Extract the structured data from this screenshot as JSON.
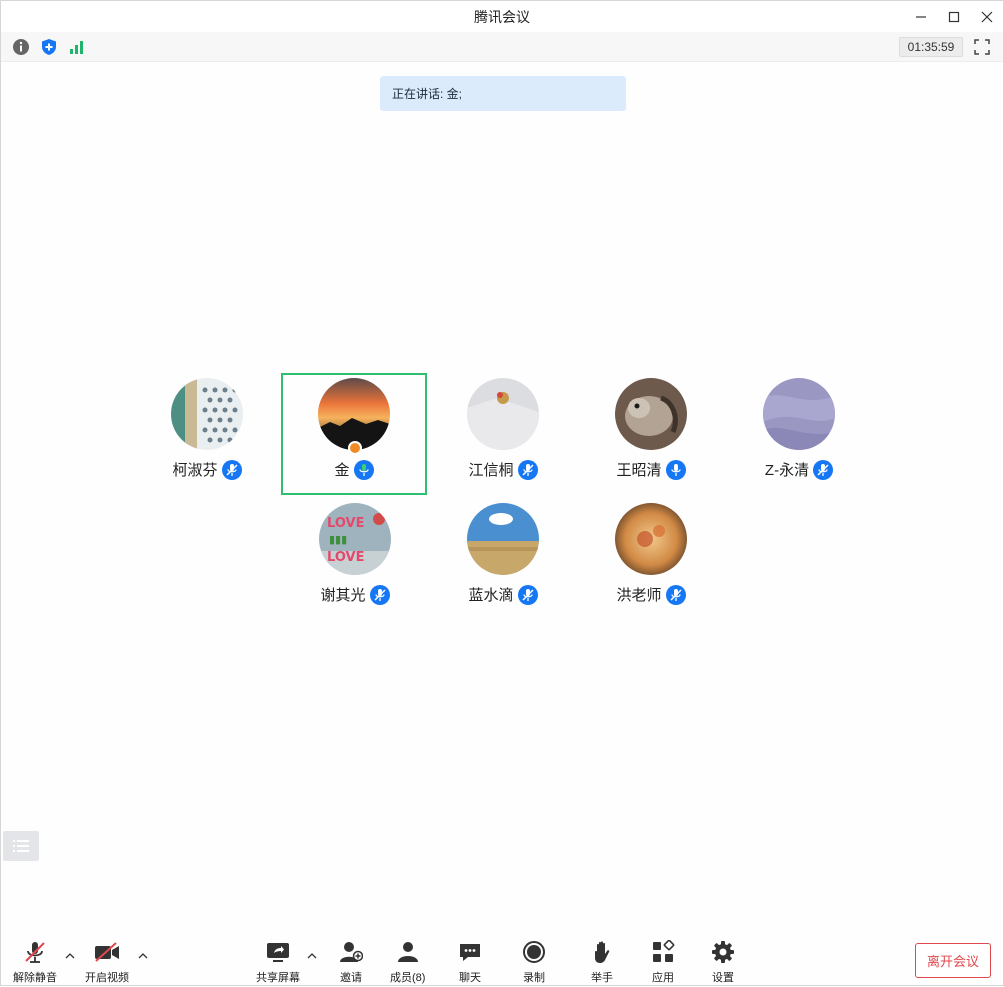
{
  "window": {
    "title": "腾讯会议"
  },
  "infobar": {
    "timer": "01:35:59"
  },
  "speaking": {
    "label": "正在讲话: 金;"
  },
  "participants": [
    {
      "name": "柯淑芬",
      "mic": "muted"
    },
    {
      "name": "金",
      "mic": "speaking",
      "host": true,
      "active": true
    },
    {
      "name": "江信桐",
      "mic": "muted"
    },
    {
      "name": "王昭清",
      "mic": "on"
    },
    {
      "name": "Z-永清",
      "mic": "muted"
    },
    {
      "name": "谢其光",
      "mic": "muted"
    },
    {
      "name": "蓝水滴",
      "mic": "muted"
    },
    {
      "name": "洪老师",
      "mic": "muted"
    }
  ],
  "toolbar": {
    "unmute": "解除静音",
    "video": "开启视频",
    "share": "共享屏幕",
    "invite": "邀请",
    "members": "成员(8)",
    "chat": "聊天",
    "record": "录制",
    "raise_hand": "举手",
    "apps": "应用",
    "settings": "设置",
    "leave": "离开会议"
  },
  "colors": {
    "accent_blue": "#1677f5",
    "speaking_green": "#2ec070",
    "leave_red": "#e0484e",
    "speaking_banner": "#dcebfb"
  }
}
